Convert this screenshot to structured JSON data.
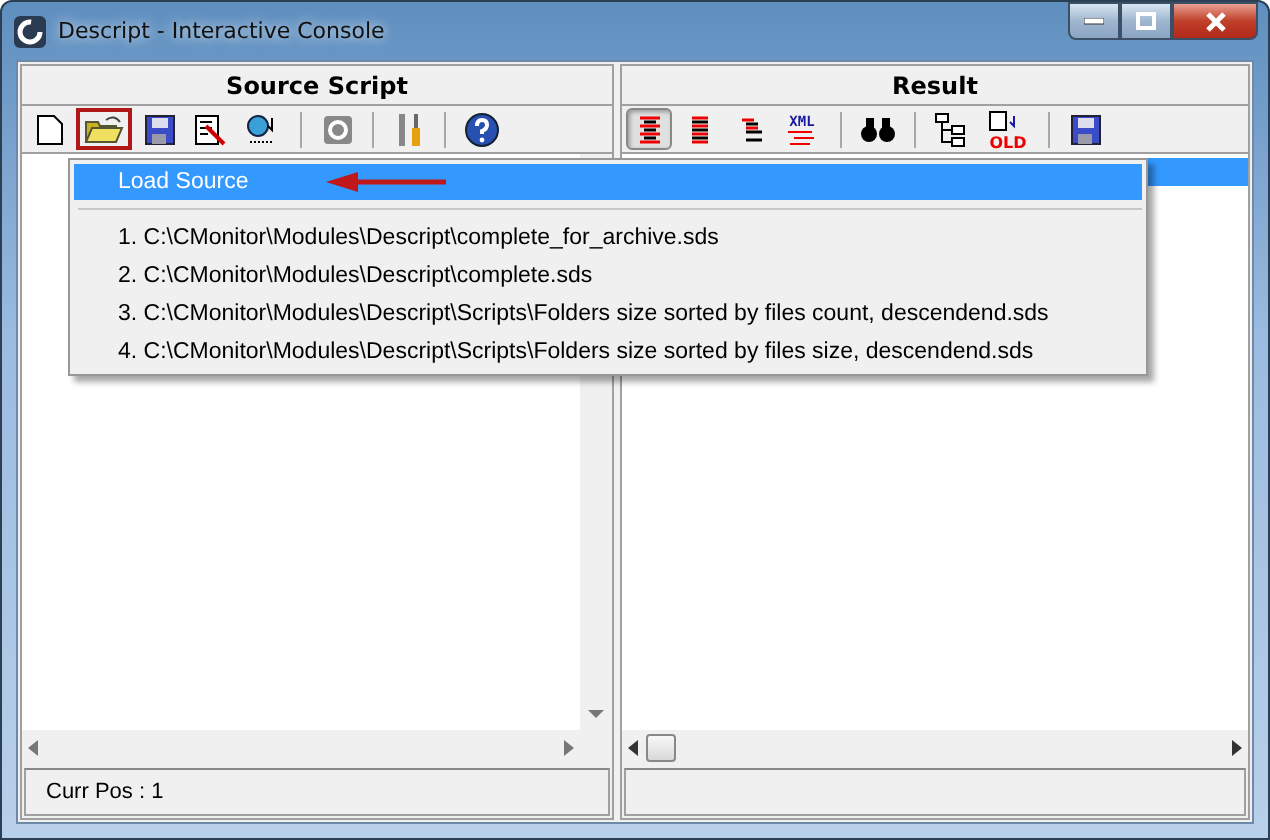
{
  "window": {
    "title": "Descript - Interactive Console"
  },
  "source_pane": {
    "title": "Source Script",
    "status": "Curr Pos : 1",
    "toolbar": [
      {
        "kind": "new",
        "highlighted": false
      },
      {
        "kind": "open",
        "highlighted": true
      },
      {
        "kind": "save",
        "highlighted": false
      },
      {
        "kind": "edit",
        "highlighted": false
      },
      {
        "kind": "compile",
        "highlighted": false
      },
      {
        "kind": "sep"
      },
      {
        "kind": "stop",
        "highlighted": false
      },
      {
        "kind": "sep"
      },
      {
        "kind": "tools",
        "highlighted": false
      },
      {
        "kind": "sep"
      },
      {
        "kind": "help",
        "highlighted": false
      }
    ]
  },
  "result_pane": {
    "title": "Result",
    "toolbar": [
      {
        "kind": "align_center",
        "selected": true
      },
      {
        "kind": "align_justify",
        "selected": false
      },
      {
        "kind": "align_right",
        "selected": false
      },
      {
        "kind": "xml",
        "label": "XML",
        "selected": false
      },
      {
        "kind": "sep"
      },
      {
        "kind": "find",
        "selected": false
      },
      {
        "kind": "sep"
      },
      {
        "kind": "tree",
        "selected": false
      },
      {
        "kind": "old",
        "label": "OLD",
        "selected": false
      },
      {
        "kind": "sep"
      },
      {
        "kind": "save",
        "selected": false
      }
    ]
  },
  "menu": {
    "items": [
      {
        "label": "Load Source",
        "selected": true,
        "pointed": true
      }
    ],
    "recent": [
      {
        "label": "1. C:\\CMonitor\\Modules\\Descript\\complete_for_archive.sds"
      },
      {
        "label": "2. C:\\CMonitor\\Modules\\Descript\\complete.sds"
      },
      {
        "label": "3. C:\\CMonitor\\Modules\\Descript\\Scripts\\Folders size sorted by files count, descendend.sds"
      },
      {
        "label": "4. C:\\CMonitor\\Modules\\Descript\\Scripts\\Folders size sorted by files size, descendend.sds"
      }
    ]
  }
}
